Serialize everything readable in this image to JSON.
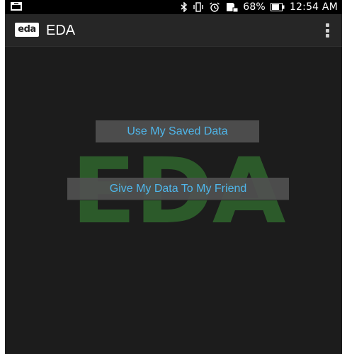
{
  "status_bar": {
    "battery": "68%",
    "time": "12:54 AM",
    "icons": [
      "notification-icon",
      "bluetooth-icon",
      "vibrate-icon",
      "alarm-icon",
      "sd-card-icon",
      "battery-icon"
    ]
  },
  "action_bar": {
    "app_icon_text": "eda",
    "title": "EDA"
  },
  "main": {
    "watermark": "EDA",
    "buttons": {
      "use_saved": "Use My Saved Data",
      "give_friend": "Give My Data To My Friend"
    }
  },
  "colors": {
    "background": "#1c1c1c",
    "action_bar": "#262626",
    "button_bg": "#4c4c4c",
    "button_text": "#4fb6ea",
    "watermark": "#2c5a2a"
  }
}
